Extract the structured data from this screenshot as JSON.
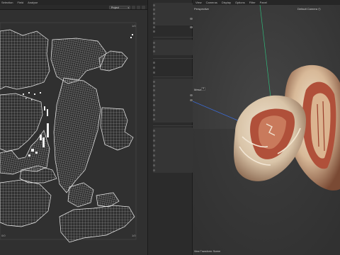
{
  "uv_menu": [
    "Selection",
    "Field",
    "Analyse"
  ],
  "uv_toolbar": {
    "project_value": "Project"
  },
  "uv_corners": {
    "top_right": "1/0",
    "bottom_left": "0/0",
    "bottom_right": "1/0"
  },
  "viewport_menu": [
    "View",
    "Cameras",
    "Display",
    "Options",
    "Filter",
    "Panel"
  ],
  "viewport": {
    "projection": "Perspective",
    "camera": "Default Camera",
    "mesh_label": "Mesa",
    "mesh_value": "0",
    "footer": "View Transform: Scene"
  },
  "colors": {
    "uv_background": "#303030",
    "uv_wire": "#e6e6e6",
    "viewport_background": "#3a3a3a",
    "shell_outer": "#e2d2bd",
    "shell_inner": "#b0503a",
    "axis_x": "#3b6bd8",
    "axis_y": "#2fb87a"
  },
  "icons": [
    "dropdown-chevron-icon",
    "camera-icon",
    "toggle-icon"
  ]
}
